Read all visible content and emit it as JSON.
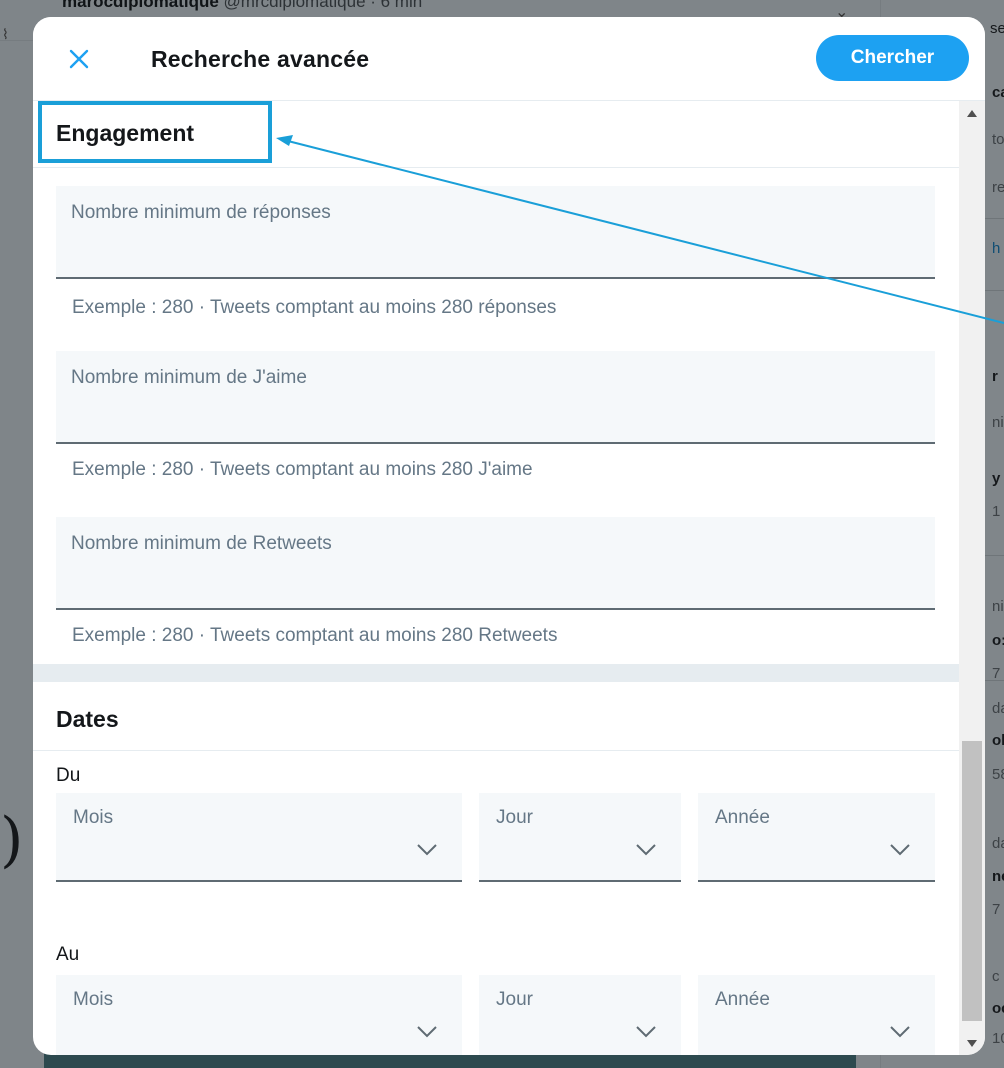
{
  "background": {
    "feed_header_name": "marocdiplomatique",
    "feed_header_meta": "@mrcdiplomatique · 6 min",
    "side_fragments": [
      "se",
      "ca",
      "to",
      "re",
      "h",
      "r",
      "ni",
      "y",
      "1",
      "ni",
      "o:",
      "7",
      "da",
      "ol",
      "58",
      "da",
      "ne",
      "7",
      "c",
      "oc",
      "10"
    ]
  },
  "modal": {
    "title": "Recherche avancée",
    "search_button": "Chercher",
    "engagement": {
      "title": "Engagement",
      "fields": [
        {
          "label": "Nombre minimum de réponses",
          "hint": "Exemple : 280 · Tweets comptant au moins 280 réponses"
        },
        {
          "label": "Nombre minimum de J'aime",
          "hint": "Exemple : 280 · Tweets comptant au moins 280 J'aime"
        },
        {
          "label": "Nombre minimum de Retweets",
          "hint": "Exemple : 280 · Tweets comptant au moins 280 Retweets"
        }
      ]
    },
    "dates": {
      "title": "Dates",
      "from_label": "Du",
      "to_label": "Au",
      "month": "Mois",
      "day": "Jour",
      "year": "Année"
    }
  },
  "colors": {
    "accent": "#1da1f2",
    "annotation": "#1a9fd8",
    "field_bg": "#f5f8fa",
    "muted_text": "#657786"
  }
}
